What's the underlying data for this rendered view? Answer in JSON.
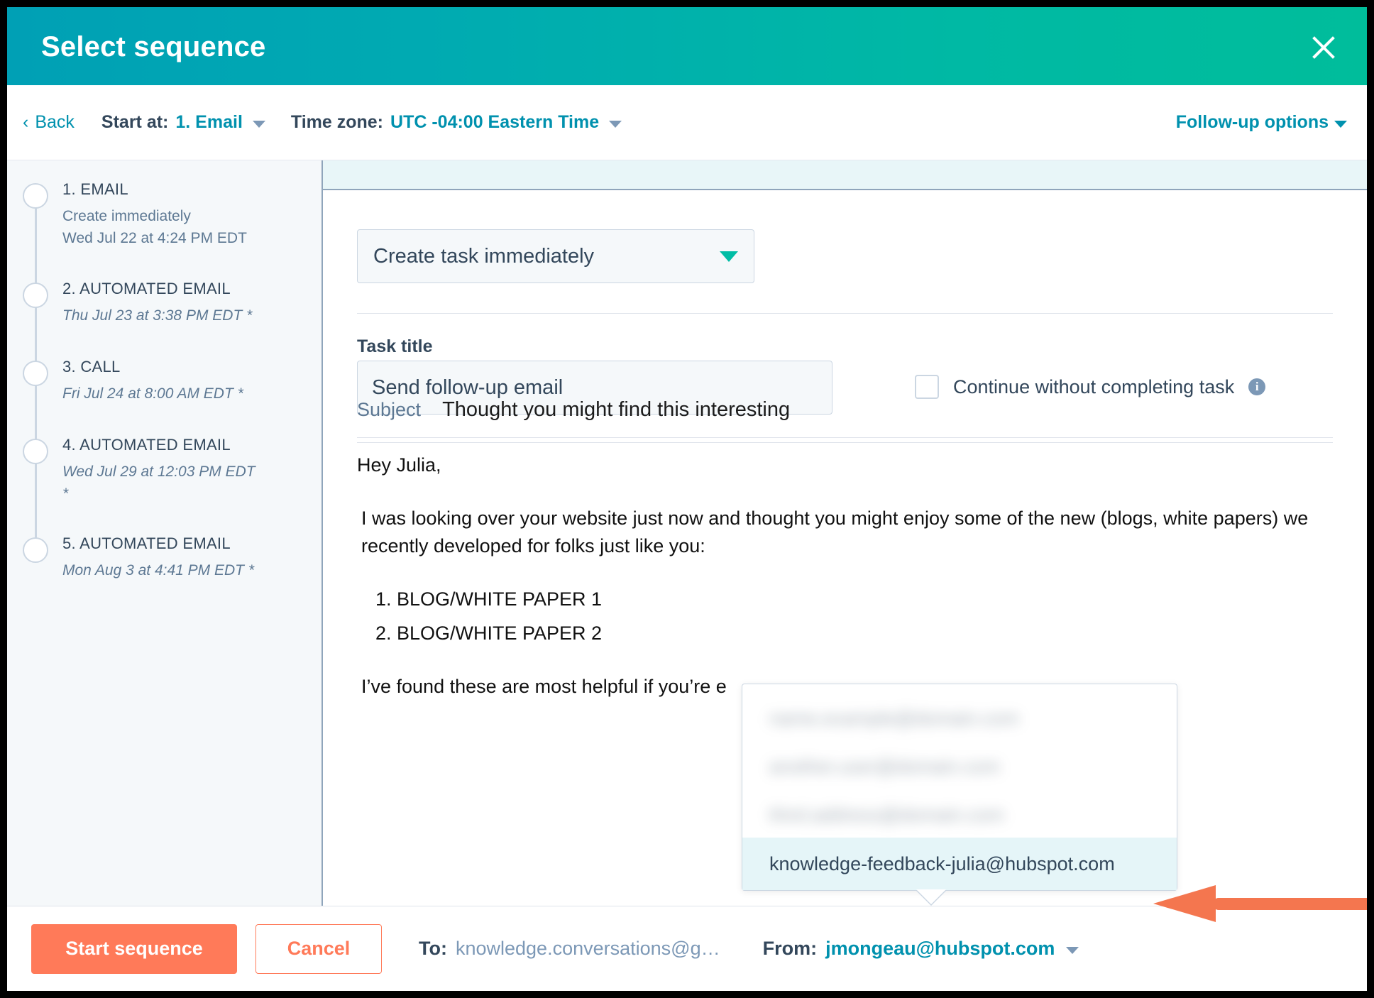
{
  "header": {
    "title": "Select sequence",
    "close_icon": "close-icon"
  },
  "toolbar": {
    "back_label": "Back",
    "start_at_label": "Start at:",
    "start_at_value": "1. Email",
    "timezone_label": "Time zone:",
    "timezone_value": "UTC -04:00 Eastern Time",
    "followup_label": "Follow-up options"
  },
  "sidebar": {
    "steps": [
      {
        "title": "1. EMAIL",
        "sub1": "Create immediately",
        "sub2": "Wed Jul 22 at 4:24 PM EDT",
        "italic": false
      },
      {
        "title": "2. AUTOMATED EMAIL",
        "sub1": "Thu Jul 23 at 3:38 PM EDT *",
        "sub2": "",
        "italic": true
      },
      {
        "title": "3. CALL",
        "sub1": "Fri Jul 24 at 8:00 AM EDT *",
        "sub2": "",
        "italic": true
      },
      {
        "title": "4. AUTOMATED EMAIL",
        "sub1": "Wed Jul 29 at 12:03 PM EDT *",
        "sub2": "",
        "italic": true
      },
      {
        "title": "5. AUTOMATED EMAIL",
        "sub1": "Mon Aug 3 at 4:41 PM EDT *",
        "sub2": "",
        "italic": true
      }
    ]
  },
  "main": {
    "task_action_value": "Create task immediately",
    "task_title_label": "Task title",
    "task_title_value": "Send follow-up email",
    "continue_checkbox_label": "Continue without completing task",
    "info_glyph": "i",
    "subject_label": "Subject",
    "subject_value": "Thought you might find this interesting",
    "body": {
      "greeting": "Hey Julia,",
      "paragraph1": "I was looking over your website just now and thought you might enjoy some of the new (blogs, white papers) we recently developed for folks just like you:",
      "list": [
        "BLOG/WHITE PAPER 1",
        "BLOG/WHITE PAPER 2"
      ],
      "paragraph2": "I’ve found these are most helpful if you’re e"
    }
  },
  "from_dropdown": {
    "options": [
      {
        "label": "",
        "blurred": true
      },
      {
        "label": "",
        "blurred": true
      },
      {
        "label": "",
        "blurred": true
      }
    ],
    "selected": "knowledge-feedback-julia@hubspot.com"
  },
  "footer": {
    "start_button": "Start sequence",
    "cancel_button": "Cancel",
    "to_label": "To:",
    "to_value": "knowledge.conversations@g…",
    "from_label": "From:",
    "from_value": "jmongeau@hubspot.com"
  },
  "annotation": {
    "arrow": "left-pointing-arrow",
    "color": "#f4764f"
  },
  "colors": {
    "header_gradient_start": "#00a0b5",
    "header_gradient_end": "#00bd9b",
    "accent_teal": "#0091ae",
    "accent_orange": "#ff7a59",
    "text_dark": "#33475b",
    "text_muted": "#5d7893",
    "border": "#cbd6e2",
    "panel_bg": "#f5f8fa",
    "selected_row": "#e5f5f8"
  }
}
